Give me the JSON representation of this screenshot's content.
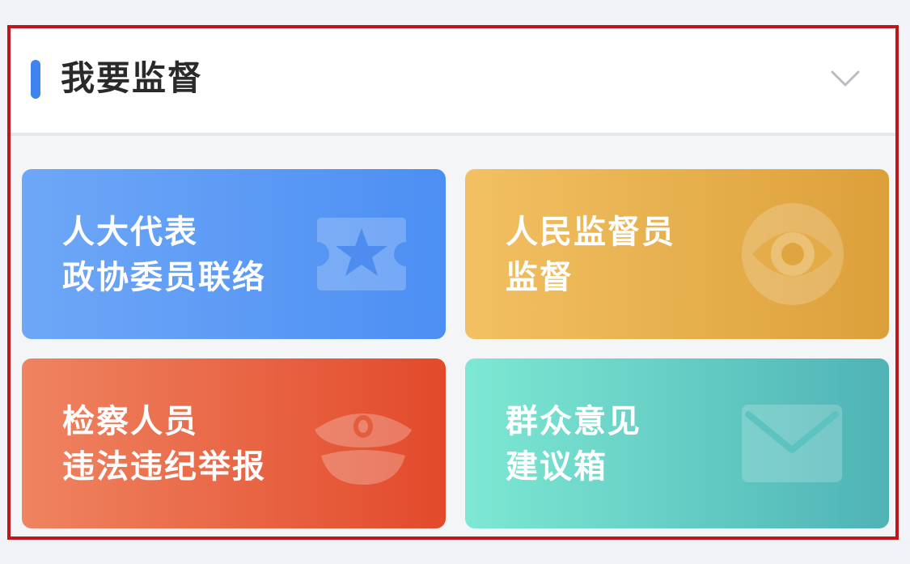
{
  "section": {
    "title": "我要监督",
    "accent_color": "#3f84ee",
    "collapse_icon": "chevron-down-icon"
  },
  "cards": [
    {
      "id": "npc-cppcc",
      "line1": "人大代表",
      "line2": "政协委员联络",
      "icon": "ticket-star-icon",
      "color": "#4c8ff3"
    },
    {
      "id": "people-supervisor",
      "line1": "人民监督员",
      "line2": "监督",
      "icon": "eye-icon",
      "color": "#dca03a"
    },
    {
      "id": "prosecutor-report",
      "line1": "检察人员",
      "line2": "违法违纪举报",
      "icon": "police-cap-icon",
      "color": "#e24a2b"
    },
    {
      "id": "public-opinion",
      "line1": "群众意见",
      "line2": "建议箱",
      "icon": "mail-icon",
      "color": "#4fb3b6"
    }
  ]
}
